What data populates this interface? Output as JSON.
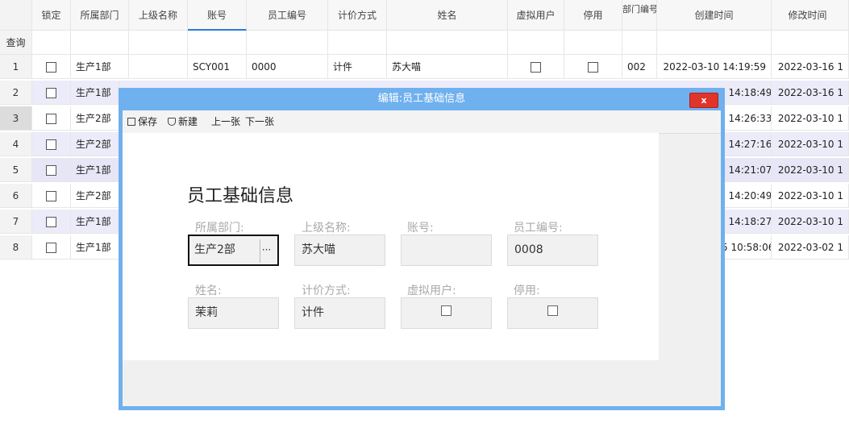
{
  "grid": {
    "columns": [
      "锁定",
      "所属部门",
      "上级名称",
      "账号",
      "员工编号",
      "计价方式",
      "姓名",
      "虚拟用户",
      "停用",
      "部门编号",
      "创建时间",
      "修改时间"
    ],
    "query_label": "查询",
    "rows": [
      {
        "n": "1",
        "dept": "生产1部",
        "acct": "SCY001",
        "empno": "0000",
        "price": "计件",
        "name": "苏大喵",
        "deptno": "002",
        "created": "2022-03-10 14:19:59",
        "modified": "2022-03-16 1"
      },
      {
        "n": "2",
        "dept": "生产1部",
        "created": ") 14:18:49",
        "modified": "2022-03-16 1"
      },
      {
        "n": "3",
        "dept": "生产2部",
        "created": ") 14:26:33",
        "modified": "2022-03-10 1"
      },
      {
        "n": "4",
        "dept": "生产2部",
        "created": ") 14:27:16",
        "modified": "2022-03-10 1"
      },
      {
        "n": "5",
        "dept": "生产1部",
        "created": ") 14:21:07",
        "modified": "2022-03-10 1"
      },
      {
        "n": "6",
        "dept": "生产2部",
        "created": ") 14:20:49",
        "modified": "2022-03-10 1"
      },
      {
        "n": "7",
        "dept": "生产1部",
        "created": ") 14:18:27",
        "modified": "2022-03-10 1"
      },
      {
        "n": "8",
        "dept": "生产1部",
        "created": "5 10:58:06",
        "modified": "2022-03-02 1"
      }
    ]
  },
  "dialog": {
    "title": "编辑:员工基础信息",
    "close": "x",
    "toolbar": {
      "save": "保存",
      "new": "新建",
      "prev": "上一张",
      "next": "下一张"
    },
    "heading": "员工基础信息",
    "fields": {
      "dept_label": "所属部门:",
      "dept_value": "生产2部",
      "ellipsis": "···",
      "parent_label": "上级名称:",
      "parent_value": "苏大喵",
      "acct_label": "账号:",
      "acct_value": "",
      "empno_label": "员工编号:",
      "empno_value": "0008",
      "name_label": "姓名:",
      "name_value": "茉莉",
      "price_label": "计价方式:",
      "price_value": "计件",
      "virtual_label": "虚拟用户:",
      "disabled_label": "停用:"
    }
  },
  "colors": {
    "accent": "#2c7cd3",
    "dialog_frame": "#6fb0ee",
    "close": "#e0352b",
    "row_alt": "#ecebf9"
  },
  "icons": [
    "save-icon",
    "new-icon",
    "checkbox-icon"
  ]
}
